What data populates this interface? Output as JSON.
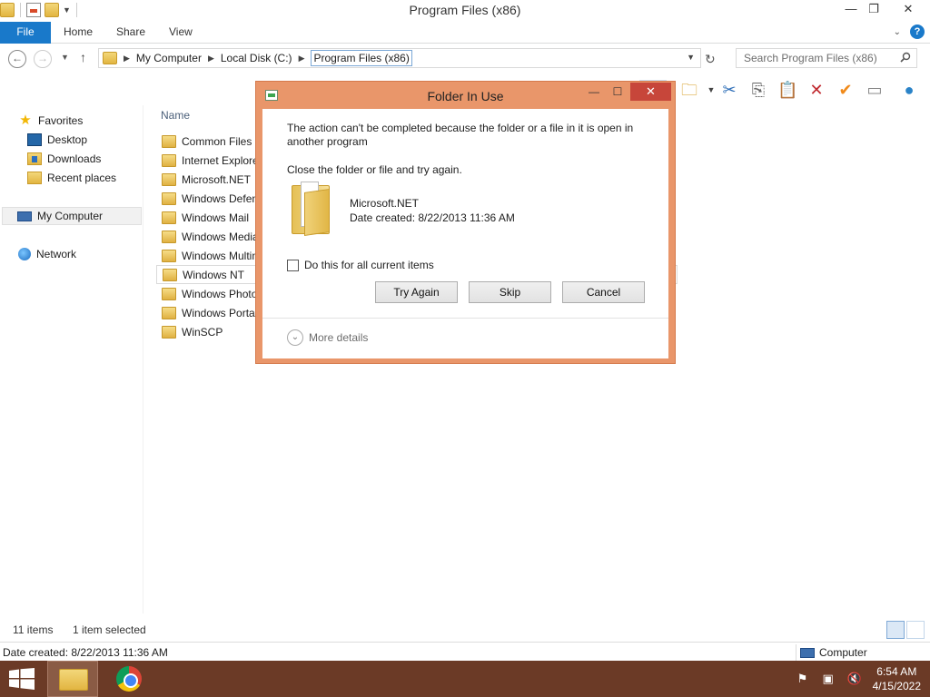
{
  "window": {
    "title": "Program Files (x86)",
    "minimize": "—",
    "maximize": "❐",
    "close": "✕"
  },
  "ribbon": {
    "tabs": [
      "File",
      "Home",
      "Share",
      "View"
    ],
    "help": "?"
  },
  "address": {
    "crumbs": [
      "My Computer",
      "Local Disk (C:)",
      "Program Files (x86)"
    ],
    "search_placeholder": "Search Program Files (x86)"
  },
  "navpane": {
    "favorites": "Favorites",
    "desktop": "Desktop",
    "downloads": "Downloads",
    "recent": "Recent places",
    "computer": "My Computer",
    "network": "Network"
  },
  "filelist": {
    "column_name": "Name",
    "files": [
      "Common Files",
      "Internet Explore",
      "Microsoft.NET",
      "Windows Defen",
      "Windows Mail",
      "Windows Media",
      "Windows Multin",
      "Windows NT",
      "Windows Photo",
      "Windows Portab",
      "WinSCP"
    ],
    "selected_index": 7
  },
  "status": {
    "items": "11 items",
    "selected": "1 item selected",
    "date_created": "Date created: 8/22/2013 11:36 AM",
    "location": "Computer"
  },
  "taskbar": {
    "time": "6:54 AM",
    "date": "4/15/2022"
  },
  "dialog": {
    "title": "Folder In Use",
    "message": "The action can't be completed because the folder or a file in it is open in another program",
    "instruction": "Close the folder or file and try again.",
    "file_name": "Microsoft.NET",
    "file_date": "Date created: 8/22/2013 11:36 AM",
    "checkbox_label": "Do this for all current items",
    "checkbox_checked": false,
    "buttons": {
      "try_again": "Try Again",
      "skip": "Skip",
      "cancel": "Cancel"
    },
    "more_details": "More details"
  },
  "colors": {
    "dialog_frame": "#e9966a",
    "accent_blue": "#1979ca",
    "taskbar": "#6b3a26",
    "close_red": "#c7463a"
  }
}
